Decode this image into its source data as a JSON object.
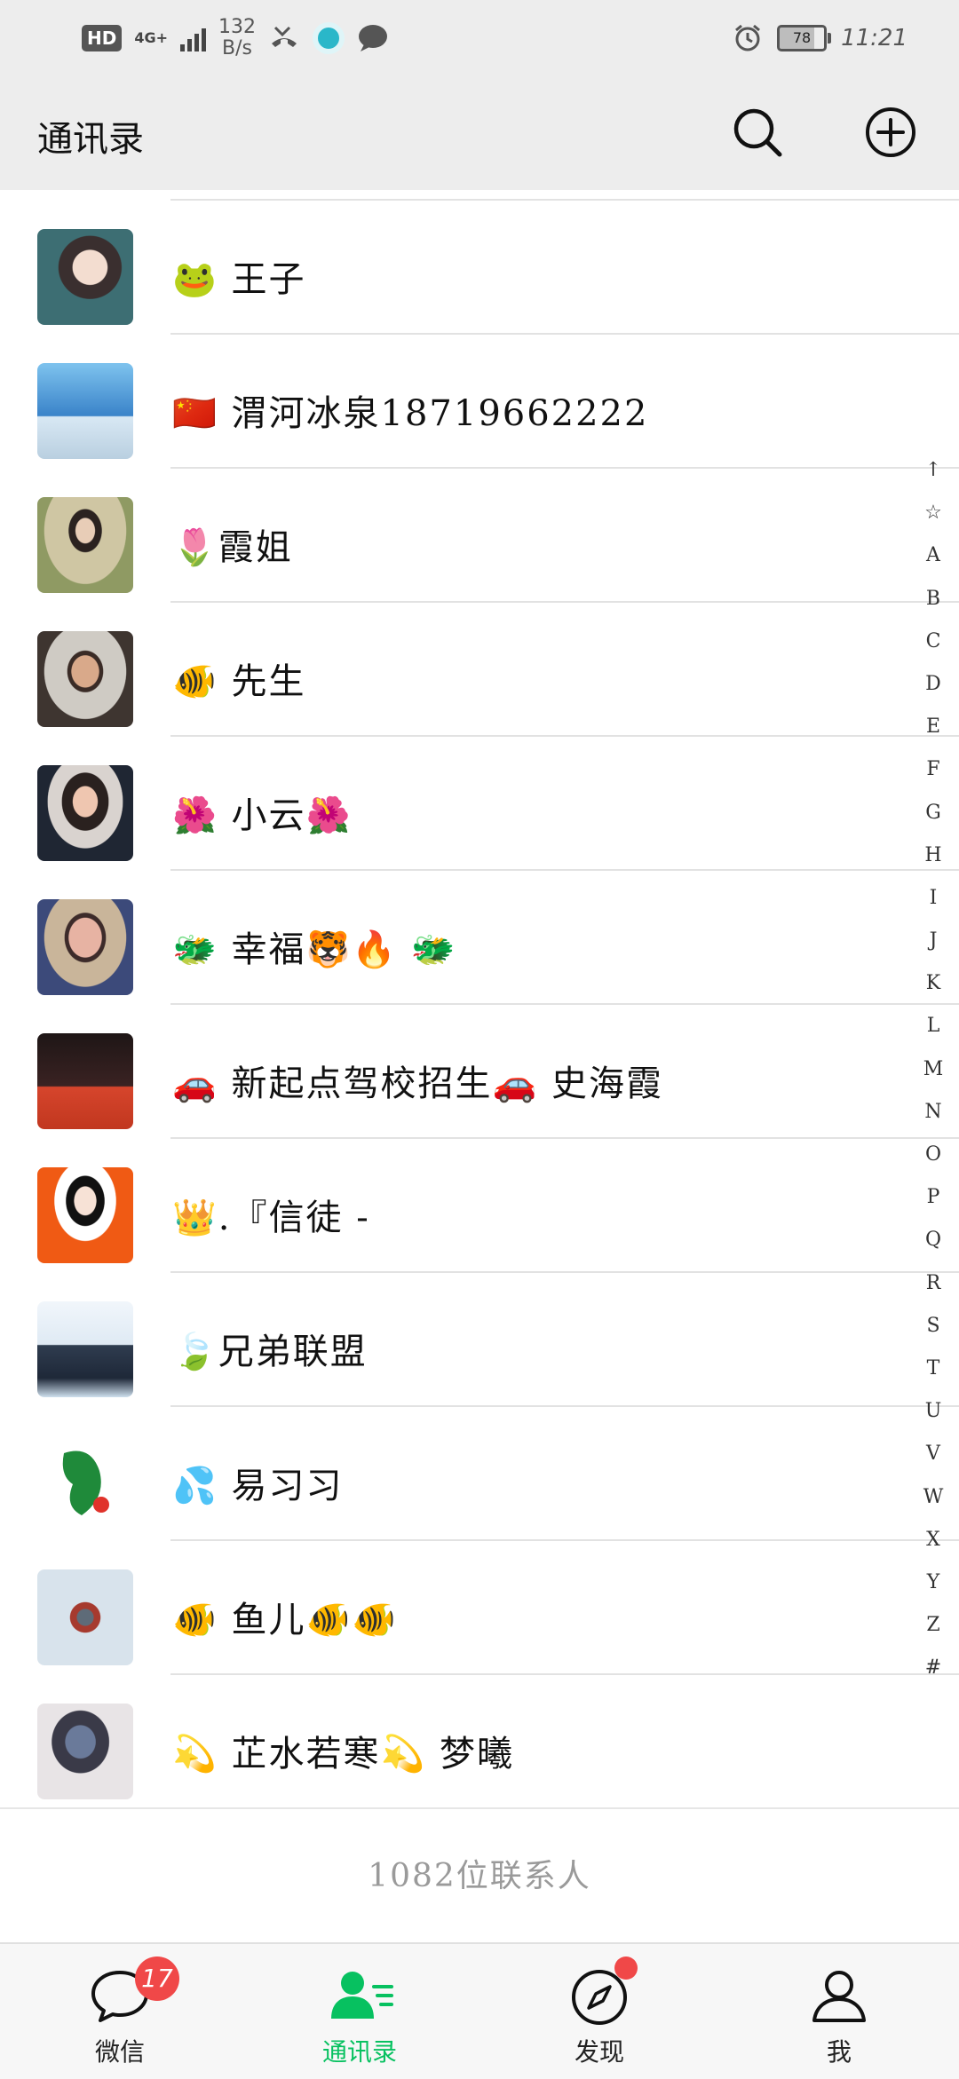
{
  "status_bar": {
    "hd": "HD",
    "network": "4G+",
    "speed_value": "132",
    "speed_unit": "B/s",
    "battery": "78",
    "time": "11:21"
  },
  "header": {
    "title": "通讯录"
  },
  "contacts": [
    {
      "name": "🐸 王子"
    },
    {
      "name": "🇨🇳 渭河冰泉18719662222"
    },
    {
      "name": "🌷霞姐"
    },
    {
      "name": "🐠 先生"
    },
    {
      "name": "🌺 小云🌺"
    },
    {
      "name": "🐲 幸福🐯🔥 🐲"
    },
    {
      "name": "🚗 新起点驾校招生🚗 史海霞"
    },
    {
      "name": "👑.『信徒 -"
    },
    {
      "name": "🍃兄弟联盟"
    },
    {
      "name": "💦 易习习"
    },
    {
      "name": "🐠 鱼儿🐠🐠"
    },
    {
      "name": "💫 芷水若寒💫  梦曦"
    }
  ],
  "alphabet_index": [
    "↑",
    "☆",
    "A",
    "B",
    "C",
    "D",
    "E",
    "F",
    "G",
    "H",
    "I",
    "J",
    "K",
    "L",
    "M",
    "N",
    "O",
    "P",
    "Q",
    "R",
    "S",
    "T",
    "U",
    "V",
    "W",
    "X",
    "Y",
    "Z",
    "#"
  ],
  "contact_count": "1082位联系人",
  "bottom_nav": {
    "items": [
      {
        "label": "微信",
        "badge": "17"
      },
      {
        "label": "通讯录"
      },
      {
        "label": "发现"
      },
      {
        "label": "我"
      }
    ],
    "active_color": "#07c160"
  }
}
